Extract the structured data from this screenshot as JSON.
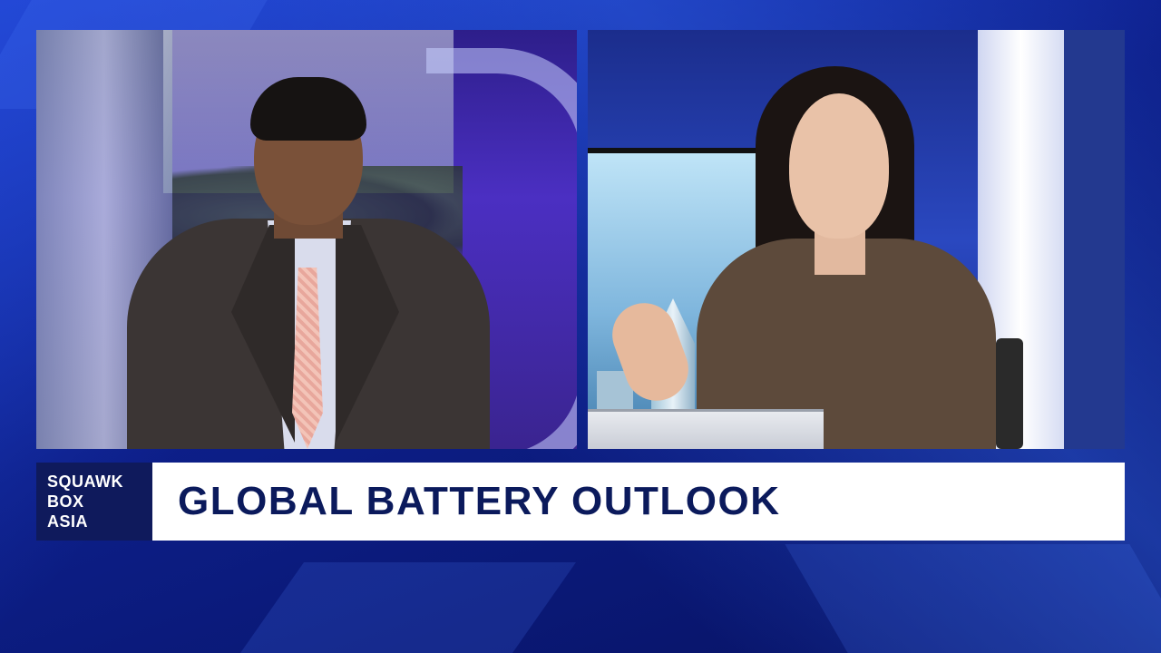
{
  "show": {
    "name_line1": "SQUAWK",
    "name_line2": "BOX",
    "name_line3": "ASIA"
  },
  "headline": "GLOBAL BATTERY OUTLOOK",
  "colors": {
    "background": "#0b1a6e",
    "logo_box": "#0f1a5c",
    "headline_bar": "#ffffff",
    "headline_text": "#0b1a5c"
  }
}
